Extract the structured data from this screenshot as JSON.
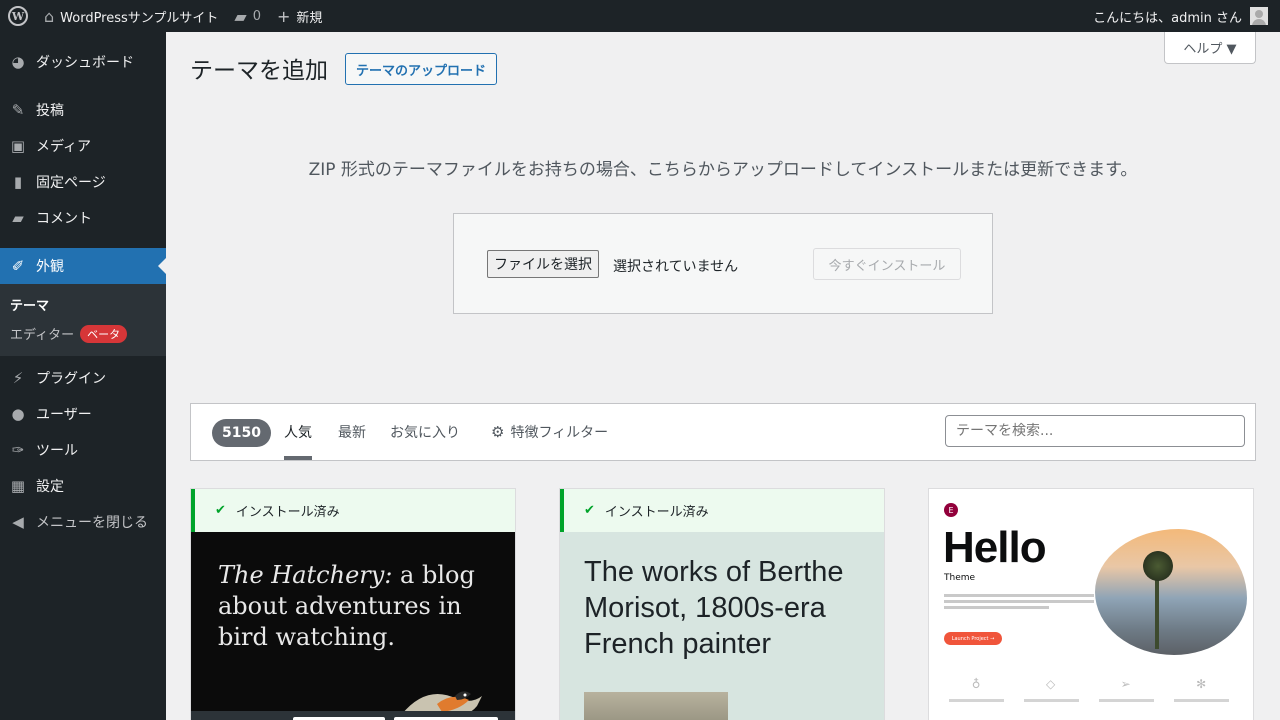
{
  "adminbar": {
    "site_name": "WordPressサンプルサイト",
    "comments_count": "0",
    "new_label": "新規",
    "greeting": "こんにちは、admin さん"
  },
  "sidebar": {
    "items": [
      {
        "label": "ダッシュボード",
        "icon": "dashboard-icon"
      },
      {
        "label": "投稿",
        "icon": "pin-icon"
      },
      {
        "label": "メディア",
        "icon": "media-icon"
      },
      {
        "label": "固定ページ",
        "icon": "page-icon"
      },
      {
        "label": "コメント",
        "icon": "comment-icon"
      },
      {
        "label": "外観",
        "icon": "brush-icon"
      },
      {
        "label": "プラグイン",
        "icon": "plugin-icon"
      },
      {
        "label": "ユーザー",
        "icon": "user-icon"
      },
      {
        "label": "ツール",
        "icon": "wrench-icon"
      },
      {
        "label": "設定",
        "icon": "settings-icon"
      },
      {
        "label": "メニューを閉じる",
        "icon": "collapse-icon"
      }
    ],
    "submenu": {
      "themes": "テーマ",
      "editor": "エディター",
      "beta_badge": "ベータ"
    }
  },
  "help_tab": "ヘルプ ▼",
  "page_title": "テーマを追加",
  "upload_button": "テーマのアップロード",
  "upload_description": "ZIP 形式のテーマファイルをお持ちの場合、こちらからアップロードしてインストールまたは更新できます。",
  "upload_form": {
    "file_button": "ファイルを選択",
    "file_status": "選択されていません",
    "install_button": "今すぐインストール"
  },
  "filter": {
    "count": "5150",
    "tabs": [
      "人気",
      "最新",
      "お気に入り"
    ],
    "feature_filter": "特徴フィルター",
    "search_placeholder": "テーマを検索..."
  },
  "themes": [
    {
      "installed_label": "インストール済み",
      "preview_text_italic": "The Hatchery:",
      "preview_text": " a blog about adventures in bird watching."
    },
    {
      "installed_label": "インストール済み",
      "preview_text": "The works of Berthe Morisot, 1800s-era French painter"
    },
    {
      "logo_letter": "E",
      "title": "Hello",
      "subtitle": "Theme",
      "cta": "Launch Project →"
    }
  ]
}
